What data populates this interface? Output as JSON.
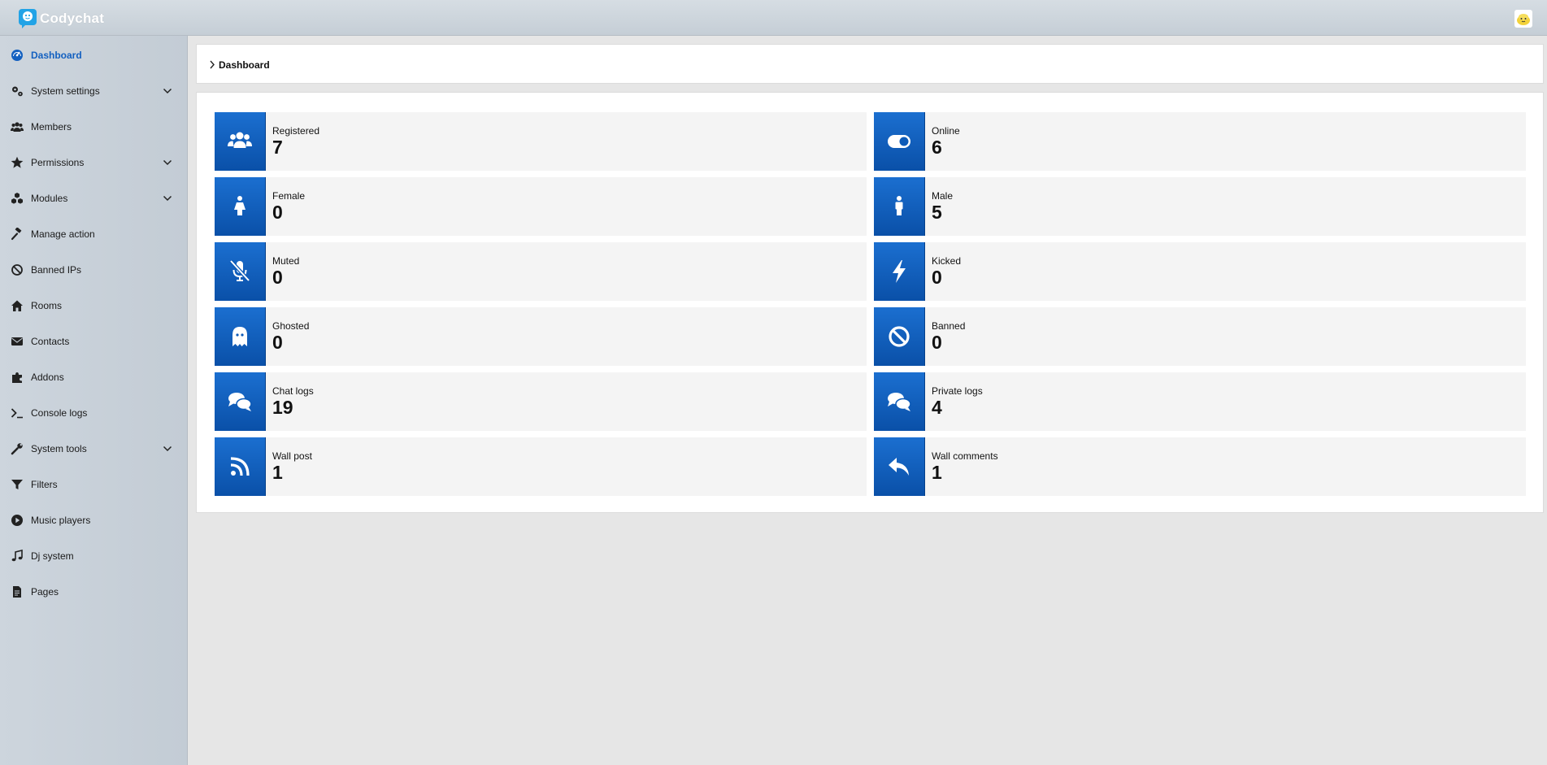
{
  "app": {
    "name": "Codychat"
  },
  "breadcrumb": {
    "current": "Dashboard"
  },
  "sidebar": {
    "items": [
      {
        "label": "Dashboard",
        "icon": "dashboard-icon",
        "active": true,
        "expandable": false
      },
      {
        "label": "System settings",
        "icon": "cogs-icon",
        "active": false,
        "expandable": true
      },
      {
        "label": "Members",
        "icon": "users-icon",
        "active": false,
        "expandable": false
      },
      {
        "label": "Permissions",
        "icon": "star-icon",
        "active": false,
        "expandable": true
      },
      {
        "label": "Modules",
        "icon": "cubes-icon",
        "active": false,
        "expandable": true
      },
      {
        "label": "Manage action",
        "icon": "gavel-icon",
        "active": false,
        "expandable": false
      },
      {
        "label": "Banned IPs",
        "icon": "ban-icon",
        "active": false,
        "expandable": false
      },
      {
        "label": "Rooms",
        "icon": "home-icon",
        "active": false,
        "expandable": false
      },
      {
        "label": "Contacts",
        "icon": "envelope-icon",
        "active": false,
        "expandable": false
      },
      {
        "label": "Addons",
        "icon": "puzzle-icon",
        "active": false,
        "expandable": false
      },
      {
        "label": "Console logs",
        "icon": "terminal-icon",
        "active": false,
        "expandable": false
      },
      {
        "label": "System tools",
        "icon": "wrench-icon",
        "active": false,
        "expandable": true
      },
      {
        "label": "Filters",
        "icon": "filter-icon",
        "active": false,
        "expandable": false
      },
      {
        "label": "Music players",
        "icon": "play-circle-icon",
        "active": false,
        "expandable": false
      },
      {
        "label": "Dj system",
        "icon": "music-icon",
        "active": false,
        "expandable": false
      },
      {
        "label": "Pages",
        "icon": "file-icon",
        "active": false,
        "expandable": false
      }
    ]
  },
  "stats": [
    {
      "label": "Registered",
      "value": "7",
      "icon": "users-icon"
    },
    {
      "label": "Online",
      "value": "6",
      "icon": "toggle-on-icon"
    },
    {
      "label": "Female",
      "value": "0",
      "icon": "female-icon"
    },
    {
      "label": "Male",
      "value": "5",
      "icon": "male-icon"
    },
    {
      "label": "Muted",
      "value": "0",
      "icon": "microphone-slash-icon"
    },
    {
      "label": "Kicked",
      "value": "0",
      "icon": "bolt-icon"
    },
    {
      "label": "Ghosted",
      "value": "0",
      "icon": "ghost-icon"
    },
    {
      "label": "Banned",
      "value": "0",
      "icon": "ban-icon"
    },
    {
      "label": "Chat logs",
      "value": "19",
      "icon": "comments-icon"
    },
    {
      "label": "Private logs",
      "value": "4",
      "icon": "comments-icon"
    },
    {
      "label": "Wall post",
      "value": "1",
      "icon": "rss-icon"
    },
    {
      "label": "Wall comments",
      "value": "1",
      "icon": "reply-icon"
    }
  ],
  "colors": {
    "accent": "#1360c0",
    "tile": "#0d5bb8",
    "sidebar": "#c9d1d9",
    "background": "#e6e6e6"
  }
}
